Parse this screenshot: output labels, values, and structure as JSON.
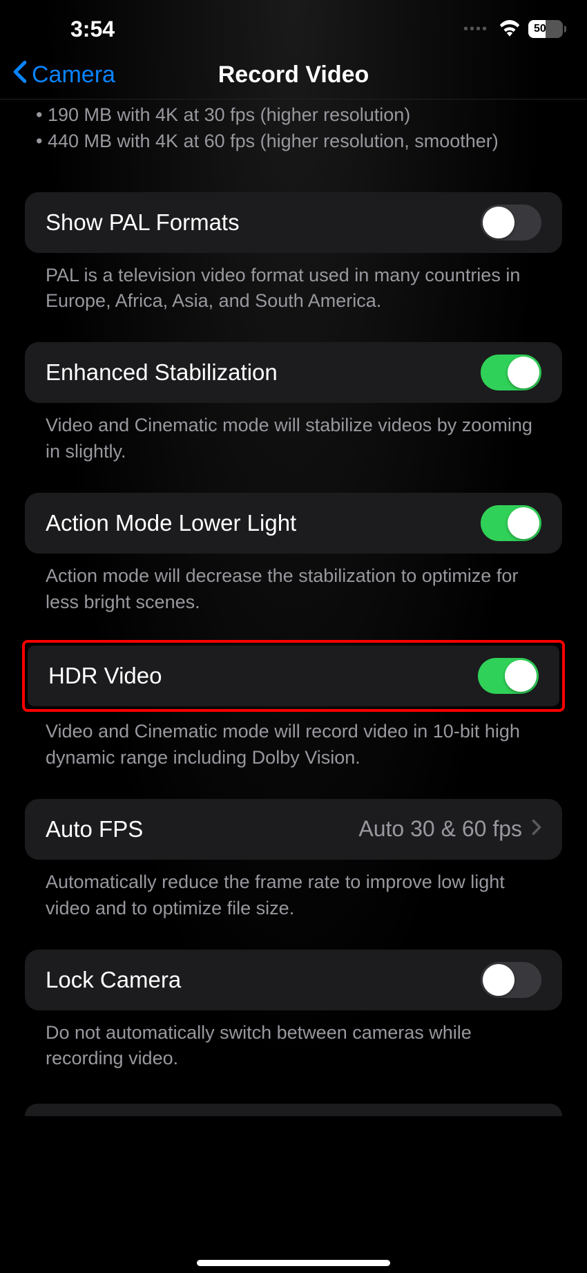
{
  "statusBar": {
    "time": "3:54",
    "batteryPercent": "50",
    "batteryFillWidth": "50%"
  },
  "nav": {
    "backLabel": "Camera",
    "title": "Record Video"
  },
  "infoLines": {
    "line1": "190 MB with 4K at 30 fps (higher resolution)",
    "line2": "440 MB with 4K at 60 fps (higher resolution, smoother)"
  },
  "settings": {
    "palFormats": {
      "label": "Show PAL Formats",
      "footer": "PAL is a television video format used in many countries in Europe, Africa, Asia, and South America.",
      "enabled": false
    },
    "enhancedStabilization": {
      "label": "Enhanced Stabilization",
      "footer": "Video and Cinematic mode will stabilize videos by zooming in slightly.",
      "enabled": true
    },
    "actionModeLowerLight": {
      "label": "Action Mode Lower Light",
      "footer": "Action mode will decrease the stabilization to optimize for less bright scenes.",
      "enabled": true
    },
    "hdrVideo": {
      "label": "HDR Video",
      "footer": "Video and Cinematic mode will record video in 10-bit high dynamic range including Dolby Vision.",
      "enabled": true
    },
    "autoFps": {
      "label": "Auto FPS",
      "value": "Auto 30 & 60 fps",
      "footer": "Automatically reduce the frame rate to improve low light video and to optimize file size."
    },
    "lockCamera": {
      "label": "Lock Camera",
      "footer": "Do not automatically switch between cameras while recording video.",
      "enabled": false
    }
  }
}
